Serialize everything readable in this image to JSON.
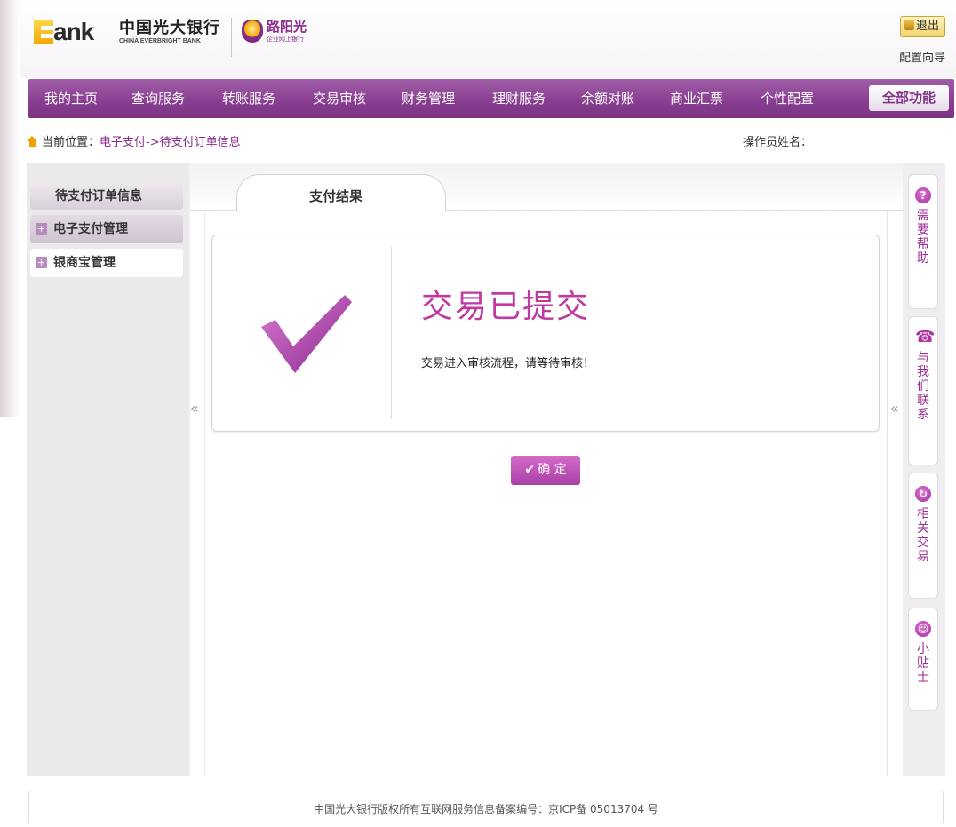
{
  "header": {
    "logo_bank": "ank",
    "bank_name_cn": "中国光大银行",
    "bank_name_en": "CHINA EVERBRIGHT BANK",
    "ygx_name": "路阳光",
    "ygx_sub": "企业网上银行",
    "exit_label": "退出",
    "config_guide": "配置向导"
  },
  "nav": {
    "items": [
      "我的主页",
      "查询服务",
      "转账服务",
      "交易审核",
      "财务管理",
      "理财服务",
      "余额对账",
      "商业汇票",
      "个性配置"
    ],
    "all_functions": "全部功能"
  },
  "breadcrumb": {
    "prefix": "当前位置：",
    "path": "电子支付->待支付订单信息",
    "operator_label": "操作员姓名："
  },
  "sidebar": {
    "title": "待支付订单信息",
    "items": [
      "电子支付管理",
      "银商宝管理"
    ]
  },
  "tab": {
    "label": "支付结果"
  },
  "result": {
    "title": "交易已提交",
    "description": "交易进入审核流程，请等待审核！",
    "ok_label": "确 定",
    "ok_icon": "✔"
  },
  "collapse": {
    "left": "«",
    "right": "«"
  },
  "tools": [
    {
      "icon": "question-icon",
      "glyph": "?",
      "label": "需要帮助"
    },
    {
      "icon": "phone-icon",
      "glyph": "☎",
      "label": "与我们联系"
    },
    {
      "icon": "refresh-icon",
      "glyph": "↻",
      "label": "相关交易"
    },
    {
      "icon": "smiley-icon",
      "glyph": "☺",
      "label": "小贴士"
    }
  ],
  "footer": {
    "text": "中国光大银行版权所有互联网服务信息备案编号：京ICP备 05013704 号"
  },
  "colors": {
    "nav_purple": "#8a3f92",
    "accent_pink": "#c0399e",
    "link_purple": "#8b2a8b"
  }
}
